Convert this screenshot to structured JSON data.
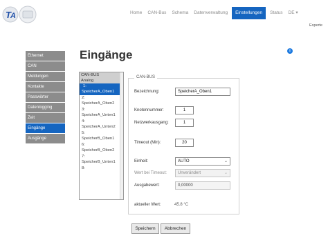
{
  "header": {
    "nav": [
      {
        "label": "Home"
      },
      {
        "label": "CAN-Bus"
      },
      {
        "label": "Schema"
      },
      {
        "label": "Datenverwaltung"
      },
      {
        "label": "Einstellungen",
        "active": true
      },
      {
        "label": "Status"
      }
    ],
    "language": "DE",
    "mode": "Experte"
  },
  "sidebar": {
    "items": [
      {
        "label": "Ethernet"
      },
      {
        "label": "CAN"
      },
      {
        "label": "Meldungen"
      },
      {
        "label": "Kontakte"
      },
      {
        "label": "Passwörter"
      },
      {
        "label": "Datenlogging"
      },
      {
        "label": "Zeit"
      },
      {
        "label": "Eingänge",
        "active": true
      },
      {
        "label": "Ausgänge"
      }
    ]
  },
  "page": {
    "title": "Eingänge"
  },
  "inputs_list": {
    "groups": [
      "CAN-BUS",
      "Analog"
    ],
    "items": [
      {
        "num": "1:",
        "name": "SpeicherA_Oben1",
        "selected": true
      },
      {
        "num": "2:",
        "name": "SpeicherA_Oben2"
      },
      {
        "num": "3:",
        "name": "SpeicherA_Unten1"
      },
      {
        "num": "4:",
        "name": "SpeicherA_Unten2"
      },
      {
        "num": "5:",
        "name": "SpeicherB_Oben1"
      },
      {
        "num": "6:",
        "name": "SpeicherB_Oben2"
      },
      {
        "num": "7:",
        "name": "SpeicherB_Unten1"
      },
      {
        "num": "8:",
        "name": ""
      }
    ]
  },
  "panel": {
    "legend": "CAN-BUS",
    "bezeichnung_label": "Bezeichnung:",
    "bezeichnung_value": "SpeicherA_Oben1",
    "knotennummer_label": "Knotennummer:",
    "knotennummer_value": "1",
    "netzwerkausgang_label": "Netzwerkausgang:",
    "netzwerkausgang_value": "1",
    "timeout_label": "Timeout (Min):",
    "timeout_value": "20",
    "einheit_label": "Einheit:",
    "einheit_value": "AUTO",
    "wert_timeout_label": "Wert bei Timeout:",
    "wert_timeout_value": "Unverändert",
    "ausgabewert_label": "Ausgabewert:",
    "ausgabewert_value": "0,00000",
    "aktueller_wert_label": "aktueller Wert:",
    "aktueller_wert_value": "45.8 °C"
  },
  "buttons": {
    "save": "Speichern",
    "cancel": "Abbrechen"
  },
  "icons": {
    "info": "info-icon",
    "logo": "ta-logo"
  },
  "colors": {
    "accent": "#1565c0",
    "sidebar": "#8c8c8c"
  }
}
